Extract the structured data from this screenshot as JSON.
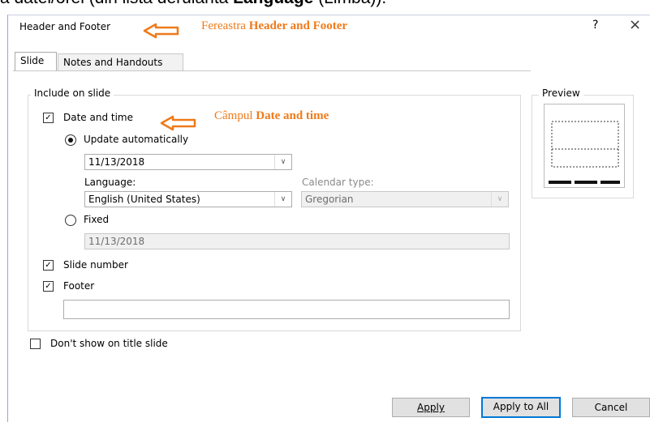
{
  "caption": {
    "text": "a datei/orei (din lista derulanta ",
    "bold": "Language",
    "rest": " (Limba))."
  },
  "window": {
    "title": "Header and Footer",
    "help": "?",
    "close": "×"
  },
  "annotations": {
    "window_note_plain": "Fereastra ",
    "window_note_bold": "Header and Footer",
    "field_note_plain": "Câmpul ",
    "field_note_bold": "Date and time",
    "arrow_color": "#ef7a1a"
  },
  "tabs": [
    {
      "label": "Slide"
    },
    {
      "label": "Notes and Handouts"
    }
  ],
  "include_group": {
    "label": "Include on slide",
    "date_time": {
      "label": "Date and time",
      "checked": true
    },
    "update_auto": {
      "label": "Update automatically",
      "selected": true,
      "value": "11/13/2018"
    },
    "language": {
      "label": "Language:",
      "value": "English (United States)"
    },
    "calendar": {
      "label": "Calendar type:",
      "value": "Gregorian"
    },
    "fixed": {
      "label": "Fixed",
      "selected": false,
      "value": "11/13/2018"
    },
    "slide_number": {
      "label": "Slide number",
      "checked": true
    },
    "footer": {
      "label": "Footer",
      "checked": true,
      "value": ""
    }
  },
  "preview": {
    "label": "Preview"
  },
  "dont_show": {
    "label": "Don't show on title slide",
    "checked": false
  },
  "buttons": {
    "apply": "Apply",
    "apply_all": "Apply to All",
    "cancel": "Cancel"
  }
}
